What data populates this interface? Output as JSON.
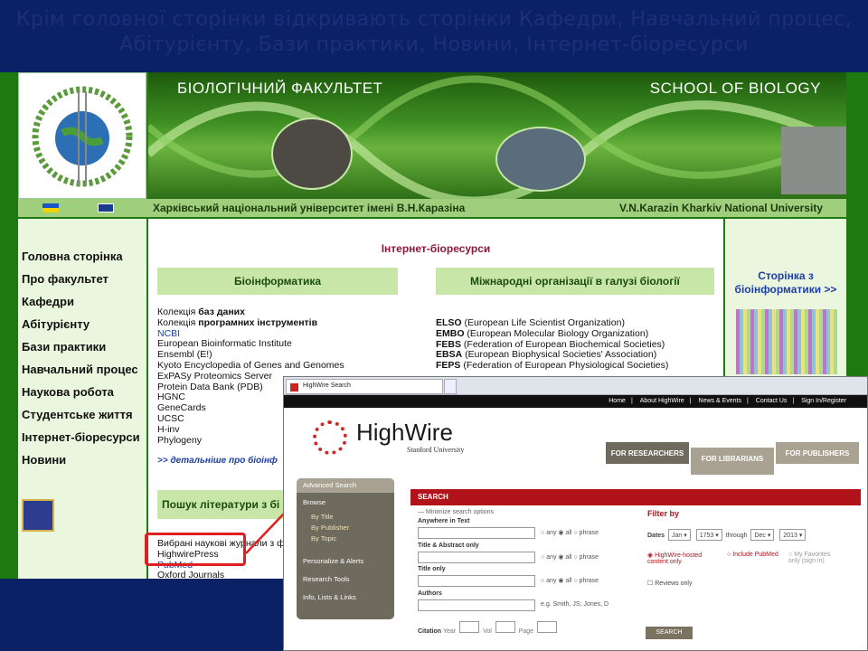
{
  "slide": {
    "title": "Крім головної сторінки відкривають сторінки Кафедри, Навчальний процес, Абітурієнту, Бази практики, Новини, Інтернет-біоресурси"
  },
  "site": {
    "banner_left": "БІОЛОГІЧНИЙ ФАКУЛЬТЕТ",
    "banner_right": "SCHOOL OF BIOLOGY",
    "univ_ua": "Харківський національний університет імені В.Н.Каразіна",
    "univ_en": "V.N.Karazin Kharkiv National University",
    "nav": [
      "Головна сторінка",
      "Про факультет",
      "Кафедри",
      "Абітурієнту",
      "Бази практики",
      "Навчальний процес",
      "Наукова робота",
      "Студентське життя",
      "Інтернет-біоресурси",
      "Новини"
    ],
    "content_title": "Інтернет-біоресурси",
    "col1_header": "Біоінформатика",
    "col2_header": "Міжнародні організації в галузі біології",
    "col1_items": [
      {
        "pre": "Колекція ",
        "bold": "баз даних"
      },
      {
        "pre": "Колекція ",
        "bold": "програмних інструментів"
      },
      {
        "link": "NCBI"
      },
      {
        "pre": "European Bioinformatic Institute"
      },
      {
        "pre": "Ensembl (E!)"
      },
      {
        "pre": "Kyoto Encyclopedia of Genes and Genomes"
      },
      {
        "pre": "ExPASy Proteomics Server"
      },
      {
        "pre": "Protein Data Bank (PDB)"
      },
      {
        "pre": "HGNC"
      },
      {
        "pre": "GeneCards"
      },
      {
        "pre": "UCSC"
      },
      {
        "pre": "H-inv"
      },
      {
        "pre": "Phylogeny"
      }
    ],
    "col1_more": ">> детальніше про біоінф",
    "col2_items": [
      {
        "bold": "ELSO",
        "rest": " (European Life Scientist Organization)"
      },
      {
        "bold": "EMBO",
        "rest": " (European Molecular Biology Organization)"
      },
      {
        "bold": "FEBS",
        "rest": " (Federation of European Biochemical Societies)"
      },
      {
        "bold": "EBSA",
        "rest": " (European Biophysical Societies' Association)"
      },
      {
        "bold": "FEPS",
        "rest": " (Federation of European Physiological Societies)"
      }
    ],
    "search_header": "Пошук літератури з бі",
    "journals": [
      "Вибрані наукові журнали з фі",
      "HighwirePress",
      "PubMed",
      "Oxford Journals"
    ],
    "right_title": "Сторінка з біоінформатики >>"
  },
  "highwire": {
    "tab_title": "HighWire Search",
    "topnav": [
      "Home",
      "|",
      "About HighWire",
      "|",
      "News & Events",
      "|",
      "Contact Us",
      "|",
      "Sign In/Register"
    ],
    "logo_word": "HighWire",
    "logo_sub": "Stanford University",
    "tabs": [
      "FOR RESEARCHERS",
      "FOR LIBRARIANS",
      "FOR PUBLISHERS"
    ],
    "left_menu": {
      "advanced": "Advanced Search",
      "browse": "Browse",
      "browse_items": [
        "By Title",
        "By Publisher",
        "By Topic"
      ],
      "others": [
        "Personalize & Alerts",
        "Research Tools",
        "Info, Lists & Links"
      ]
    },
    "search_title": "SEARCH",
    "minimize": "— Minimize search options",
    "fields": [
      "Anywhere in Text",
      "Title & Abstract only",
      "Title only",
      "Authors"
    ],
    "radio_labels": [
      "any",
      "all",
      "phrase"
    ],
    "authors_hint": "e.g. Smith, JS; Jones, D",
    "citation": {
      "label": "Citation",
      "year": "Year",
      "vol": "Vol",
      "page": "Page"
    },
    "filter": {
      "title": "Filter by",
      "dates_label": "Dates",
      "from_month": "Jan",
      "from_year": "1753",
      "through": "through",
      "to_month": "Dec",
      "to_year": "2013",
      "opt1": "HighWire-hosted content only",
      "opt2a": "Include",
      "opt2b": "PubMed",
      "opt3": "My Favorites only (sign in)",
      "reviews": "Reviews only"
    },
    "search_button": "SEARCH"
  }
}
